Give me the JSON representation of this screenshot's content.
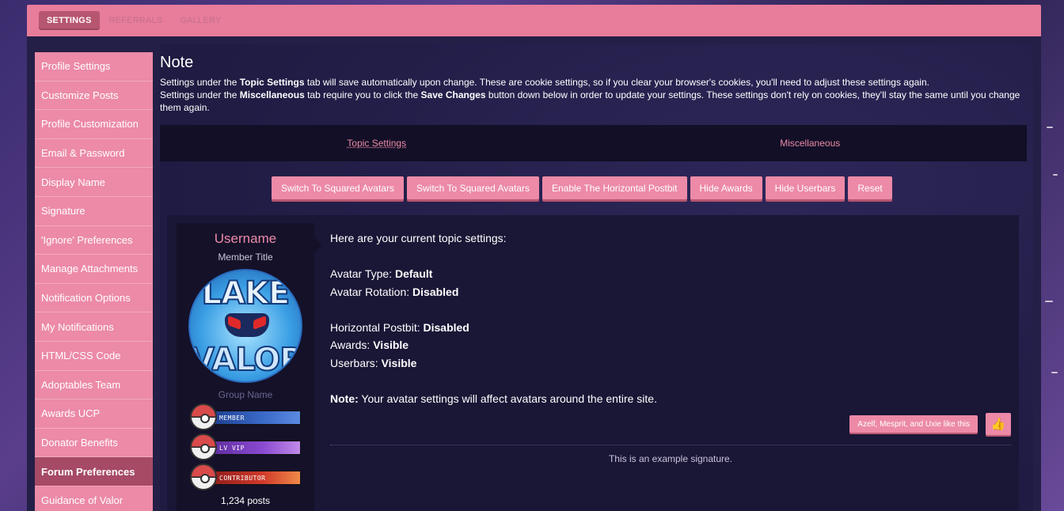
{
  "nav": {
    "tabs": [
      {
        "label": "SETTINGS"
      },
      {
        "label": "REFERRALS"
      },
      {
        "label": "GALLERY"
      }
    ]
  },
  "sidebar": {
    "items": [
      {
        "label": "Profile Settings"
      },
      {
        "label": "Customize Posts"
      },
      {
        "label": "Profile Customization"
      },
      {
        "label": "Email & Password"
      },
      {
        "label": "Display Name"
      },
      {
        "label": "Signature"
      },
      {
        "label": "'Ignore' Preferences"
      },
      {
        "label": "Manage Attachments"
      },
      {
        "label": "Notification Options"
      },
      {
        "label": "My Notifications"
      },
      {
        "label": "HTML/CSS Code"
      },
      {
        "label": "Adoptables Team"
      },
      {
        "label": "Awards UCP"
      },
      {
        "label": "Donator Benefits"
      },
      {
        "label": "Forum Preferences"
      },
      {
        "label": "Guidance of Valor"
      }
    ]
  },
  "note": {
    "title": "Note",
    "line1_a": "Settings under the ",
    "line1_b": "Topic Settings",
    "line1_c": " tab will save automatically upon change. These are cookie settings, so if you clear your browser's cookies, you'll need to adjust these settings again.",
    "line2_a": "Settings under the ",
    "line2_b": "Miscellaneous",
    "line2_c": " tab require you to click the ",
    "line2_d": "Save Changes",
    "line2_e": " button down below in order to update your settings. These settings don't rely on cookies, they'll stay the same until you change them again."
  },
  "settings_tabs": {
    "topic": "Topic Settings",
    "misc": "Miscellaneous"
  },
  "buttons": [
    {
      "label": "Switch To Squared Avatars"
    },
    {
      "label": "Switch To Squared Avatars"
    },
    {
      "label": "Enable The Horizontal Postbit"
    },
    {
      "label": "Hide Awards"
    },
    {
      "label": "Hide Userbars"
    },
    {
      "label": "Reset"
    }
  ],
  "profile": {
    "username": "Username",
    "member_title": "Member Title",
    "avatar_text_top": "LAKE",
    "avatar_text_bottom": "VALOR",
    "group_name": "Group Name",
    "userbars": [
      {
        "label": "MEMBER"
      },
      {
        "label": "LV VIP"
      },
      {
        "label": "CONTRIBUTOR"
      }
    ],
    "posts": "1,234 posts"
  },
  "post": {
    "intro": "Here are your current topic settings:",
    "avatar_type_label": "Avatar Type: ",
    "avatar_type_value": "Default",
    "avatar_rotation_label": "Avatar Rotation: ",
    "avatar_rotation_value": "Disabled",
    "horizontal_label": "Horizontal Postbit: ",
    "horizontal_value": "Disabled",
    "awards_label": "Awards: ",
    "awards_value": "Visible",
    "userbars_label": "Userbars: ",
    "userbars_value": "Visible",
    "note_label": "Note:",
    "note_text": " Your avatar settings will affect avatars around the entire site.",
    "likes_text": "Azelf, Mesprit, and Uxie like this",
    "signature": "This is an example signature."
  },
  "colors": {
    "accent": "#ec8aa7",
    "topbar": "#e87c9b",
    "active_tab": "#b7566f",
    "panel": "#241f47"
  }
}
